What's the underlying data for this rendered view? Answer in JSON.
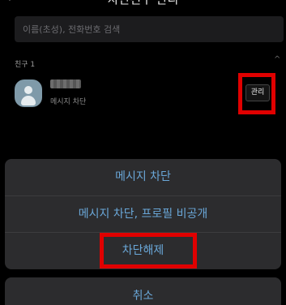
{
  "header": {
    "back_glyph": "‹",
    "title": "차단친구 관리"
  },
  "search": {
    "placeholder": "이름(초성), 전화번호 검색"
  },
  "friends_section": {
    "label": "친구 1",
    "collapse_glyph": "^"
  },
  "friend": {
    "status": "메시지 차단",
    "manage_label": "관리"
  },
  "action_sheet": {
    "items": [
      "메시지 차단",
      "메시지 차단, 프로필 비공개",
      "차단해제"
    ],
    "cancel": "취소"
  },
  "colors": {
    "accent": "#6aa7d8",
    "highlight": "#e00000",
    "sheet_bg": "#2c2c2e",
    "background": "#000000"
  }
}
